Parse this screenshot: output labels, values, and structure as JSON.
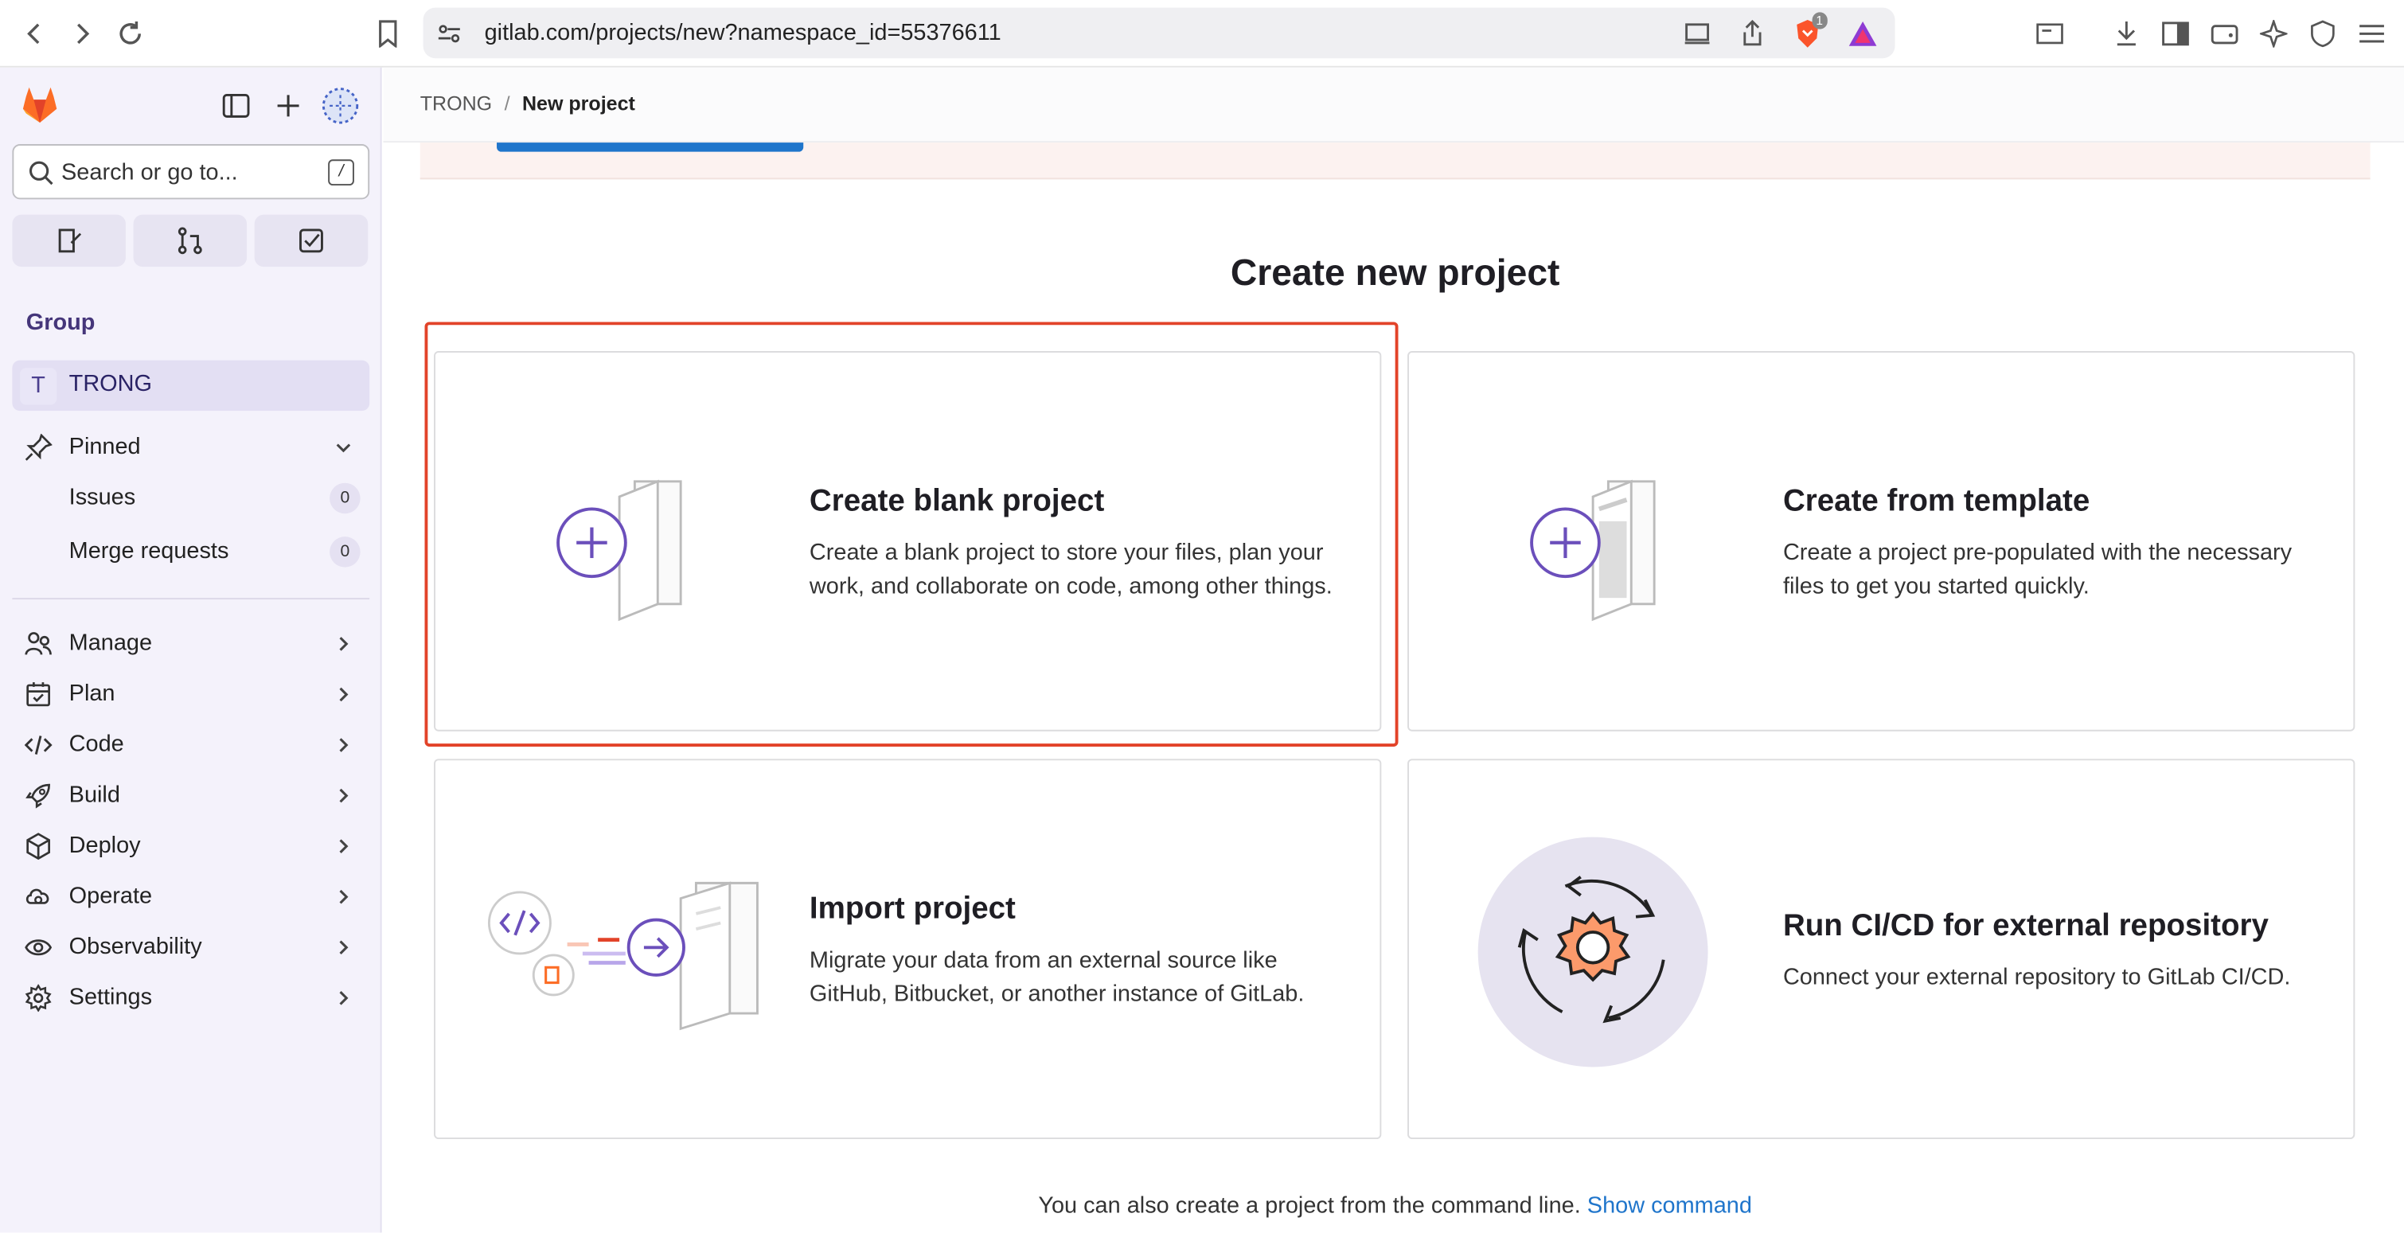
{
  "browser": {
    "url": "gitlab.com/projects/new?namespace_id=55376611",
    "brave_badge": "1"
  },
  "sidebar": {
    "search_placeholder": "Search or go to...",
    "search_shortcut": "/",
    "section_title": "Group",
    "group": {
      "avatar_letter": "T",
      "name": "TRONG"
    },
    "pinned": {
      "label": "Pinned",
      "items": [
        {
          "label": "Issues",
          "count": "0"
        },
        {
          "label": "Merge requests",
          "count": "0"
        }
      ]
    },
    "nav": [
      {
        "label": "Manage",
        "icon": "users-icon"
      },
      {
        "label": "Plan",
        "icon": "calendar-icon"
      },
      {
        "label": "Code",
        "icon": "code-icon"
      },
      {
        "label": "Build",
        "icon": "rocket-icon"
      },
      {
        "label": "Deploy",
        "icon": "deploy-icon"
      },
      {
        "label": "Operate",
        "icon": "cloud-gear-icon"
      },
      {
        "label": "Observability",
        "icon": "eye-icon"
      },
      {
        "label": "Settings",
        "icon": "gear-icon"
      }
    ]
  },
  "breadcrumb": {
    "group": "TRONG",
    "separator": "/",
    "current": "New project"
  },
  "main": {
    "title": "Create new project",
    "cards": [
      {
        "title": "Create blank project",
        "description": "Create a blank project to store your files, plan your work, and collaborate on code, among other things."
      },
      {
        "title": "Create from template",
        "description": "Create a project pre-populated with the necessary files to get you started quickly."
      },
      {
        "title": "Import project",
        "description": "Migrate your data from an external source like GitHub, Bitbucket, or another instance of GitLab."
      },
      {
        "title": "Run CI/CD for external repository",
        "description": "Connect your external repository to GitLab CI/CD."
      }
    ],
    "footer_text": "You can also create a project from the command line.",
    "footer_link": "Show command"
  },
  "colors": {
    "accent": "#6b4fbb",
    "link": "#1f75cb",
    "highlight": "#e24329",
    "sidebar_bg": "#f4f2fb"
  }
}
